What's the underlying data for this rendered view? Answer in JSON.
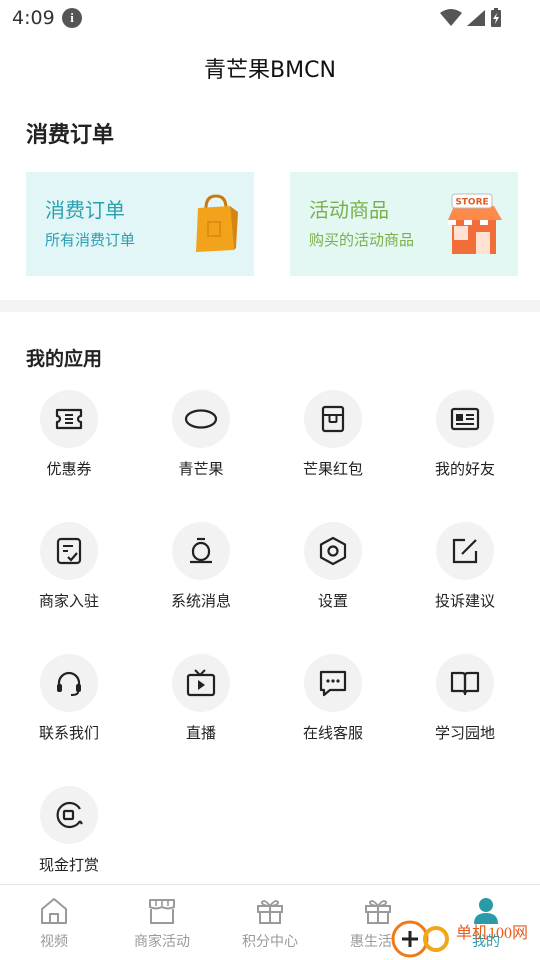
{
  "status_bar": {
    "time": "4:09"
  },
  "header": {
    "title": "青芒果BMCN"
  },
  "orders": {
    "heading": "消费订单",
    "cards": [
      {
        "title": "消费订单",
        "subtitle": "所有消费订单",
        "icon": "shopping-bag-icon"
      },
      {
        "title": "活动商品",
        "subtitle": "购买的活动商品",
        "icon": "store-icon",
        "badge": "STORE"
      }
    ]
  },
  "apps": {
    "heading": "我的应用",
    "items": [
      {
        "label": "优惠券",
        "icon": "coupon-icon"
      },
      {
        "label": "青芒果",
        "icon": "mango-icon"
      },
      {
        "label": "芒果红包",
        "icon": "red-packet-icon"
      },
      {
        "label": "我的好友",
        "icon": "id-card-icon"
      },
      {
        "label": "商家入驻",
        "icon": "merchant-join-icon"
      },
      {
        "label": "系统消息",
        "icon": "bell-icon"
      },
      {
        "label": "设置",
        "icon": "settings-icon"
      },
      {
        "label": "投诉建议",
        "icon": "edit-icon"
      },
      {
        "label": "联系我们",
        "icon": "headset-icon"
      },
      {
        "label": "直播",
        "icon": "tv-icon"
      },
      {
        "label": "在线客服",
        "icon": "chat-icon"
      },
      {
        "label": "学习园地",
        "icon": "book-icon"
      },
      {
        "label": "现金打赏",
        "icon": "cash-reward-icon"
      }
    ]
  },
  "tabbar": {
    "tabs": [
      {
        "label": "视频",
        "icon": "home-icon"
      },
      {
        "label": "商家活动",
        "icon": "shop-icon"
      },
      {
        "label": "积分中心",
        "icon": "gift-icon"
      },
      {
        "label": "惠生活区",
        "icon": "gift-icon"
      },
      {
        "label": "我的",
        "icon": "user-icon",
        "active": true
      }
    ]
  },
  "watermark": {
    "text": "单机100网"
  },
  "colors": {
    "accent": "#2a9aa8",
    "card1_text": "#2aa0b0",
    "card2_text": "#7ab04a"
  }
}
